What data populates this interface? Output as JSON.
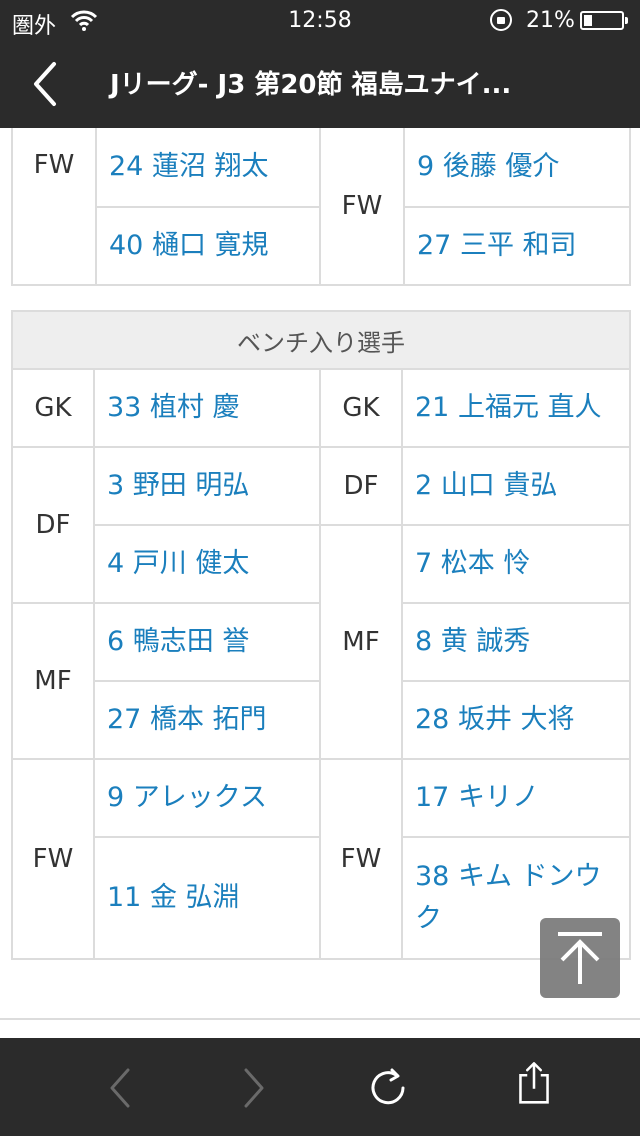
{
  "status_bar": {
    "carrier": "圏外",
    "time": "12:58",
    "battery": "21%"
  },
  "header": {
    "title": "Jリーグ- J3 第20節 福島ユナイ..."
  },
  "starters_partial": {
    "home": {
      "position": "FW",
      "players": [
        "24 蓮沼 翔太",
        "40 樋口 寛規"
      ]
    },
    "away": {
      "position": "FW",
      "players": [
        "9 後藤 優介",
        "27 三平 和司"
      ]
    }
  },
  "bench": {
    "heading": "ベンチ入り選手",
    "home": [
      {
        "position": "GK",
        "players": [
          "33 植村 慶"
        ]
      },
      {
        "position": "DF",
        "players": [
          "3 野田 明弘",
          "4 戸川 健太"
        ]
      },
      {
        "position": "MF",
        "players": [
          "6 鴨志田 誉",
          "27 橋本 拓門"
        ]
      },
      {
        "position": "FW",
        "players": [
          "9 アレックス",
          "11 金 弘淵"
        ]
      }
    ],
    "away": [
      {
        "position": "GK",
        "players": [
          "21 上福元 直人"
        ]
      },
      {
        "position": "DF",
        "players": [
          "2 山口 貴弘"
        ]
      },
      {
        "position": "MF",
        "players": [
          "7 松本 怜",
          "8 黄 誠秀",
          "28 坂井 大将"
        ]
      },
      {
        "position": "FW",
        "players": [
          "17 キリノ",
          "38 キム ドンウク"
        ]
      }
    ]
  },
  "icons": {
    "back": "chevron-left-icon",
    "scroll_top": "arrow-up-icon",
    "nav_back": "chevron-left-icon",
    "nav_forward": "chevron-right-icon",
    "reload": "reload-icon",
    "share": "share-icon"
  }
}
